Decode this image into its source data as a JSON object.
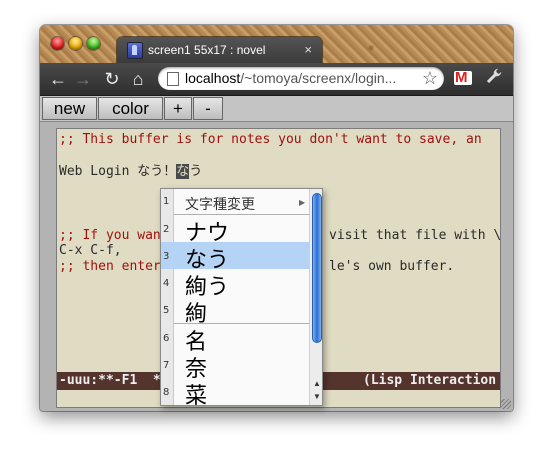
{
  "browser": {
    "tab_title": "screen1 55x17 : novel",
    "tab_close": "×",
    "url_host": "localhost",
    "url_path": "/~tomoya/screenx/login..."
  },
  "icons": {
    "back": "←",
    "forward": "→",
    "reload": "↻",
    "home": "⌂",
    "star": "☆",
    "wrench": "🔧"
  },
  "screenx_toolbar": {
    "new_label": "new",
    "color_label": "color",
    "plus_label": "+",
    "minus_label": "-"
  },
  "terminal": {
    "line1": ";; This buffer is for notes you don't want to save, an",
    "line3_prefix": "Web Login なう！",
    "line3_cursor": "な",
    "line3_suffix": "う",
    "line6_a": ";; If you wan",
    "line6_b": "visit that file with \\",
    "line7": "C-x C-f,",
    "line8_a": ";; then enter",
    "line8_b": "le's own buffer.",
    "mode_left": "-uuu:**-F1  *",
    "mode_right": "(Lisp Interaction"
  },
  "ime_candidates": {
    "items": [
      {
        "num": "1",
        "text": "文字種変更"
      },
      {
        "num": "2",
        "text": "ナウ"
      },
      {
        "num": "3",
        "text": "なう"
      },
      {
        "num": "4",
        "text": "絢う"
      },
      {
        "num": "5",
        "text": "絢"
      },
      {
        "num": "6",
        "text": "名"
      },
      {
        "num": "7",
        "text": "奈"
      },
      {
        "num": "8",
        "text": "菜"
      }
    ],
    "selected_index": 3,
    "submenu_arrow": "▶"
  },
  "colors": {
    "terminal_bg": "#e0dcc3",
    "comment": "#a01010",
    "modeline_bg": "#54342c",
    "selection": "#b5d3f5"
  }
}
